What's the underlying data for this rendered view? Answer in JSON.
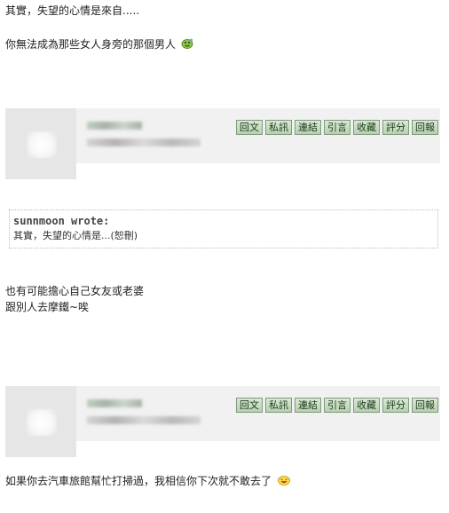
{
  "post1": {
    "line1": "其實，失望的心情是來自.....",
    "line2": "你無法成為那些女人身旁的那個男人",
    "emoji_icon": "smiley-emoji-icon"
  },
  "toolbar": {
    "reply": "回文",
    "pm": "私訊",
    "link": "連結",
    "quote": "引言",
    "favorite": "收藏",
    "rate": "評分",
    "report": "回報"
  },
  "post2": {
    "quote_author": "sunnmoon wrote:",
    "quote_text": "其實，失望的心情是...(恕刪)",
    "line1": "也有可能擔心自己女友或老婆",
    "line2": "跟別人去摩鐵~唉"
  },
  "post3": {
    "line1": "如果你去汽車旅館幫忙打掃過，我相信你下次就不敢去了",
    "emoji_icon": "laugh-emoji-icon"
  },
  "colors": {
    "button_bg": "#c7dcc0",
    "button_border": "#7f9a7f",
    "bar_bg": "#f1f1f1"
  }
}
